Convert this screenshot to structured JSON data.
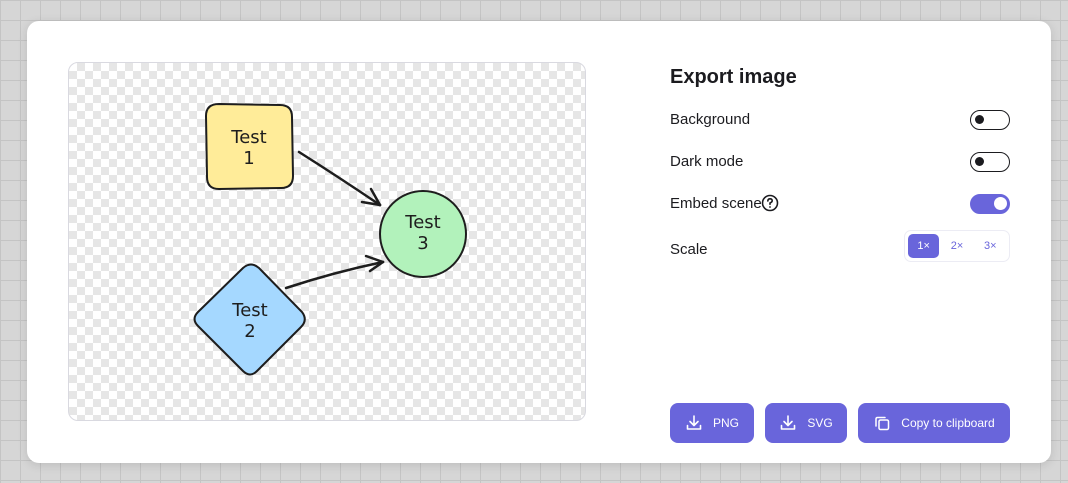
{
  "preview": {
    "shapes": [
      {
        "label_line1": "Test",
        "label_line2": "1",
        "fill": "#ffec99"
      },
      {
        "label_line1": "Test",
        "label_line2": "2",
        "fill": "#a5d8ff"
      },
      {
        "label_line1": "Test",
        "label_line2": "3",
        "fill": "#b2f2bb"
      }
    ]
  },
  "panel": {
    "title": "Export image",
    "options": [
      {
        "label": "Background",
        "enabled": false
      },
      {
        "label": "Dark mode",
        "enabled": false
      },
      {
        "label": "Embed scene",
        "enabled": true,
        "help_icon": "question-circle-icon"
      }
    ],
    "scale": {
      "label": "Scale",
      "options": [
        "1×",
        "2×",
        "3×"
      ],
      "selected": "1×"
    },
    "buttons": {
      "png": "PNG",
      "svg": "SVG",
      "clipboard": "Copy to clipboard"
    }
  },
  "colors": {
    "accent": "#6965db",
    "text": "#1b1b1f"
  }
}
